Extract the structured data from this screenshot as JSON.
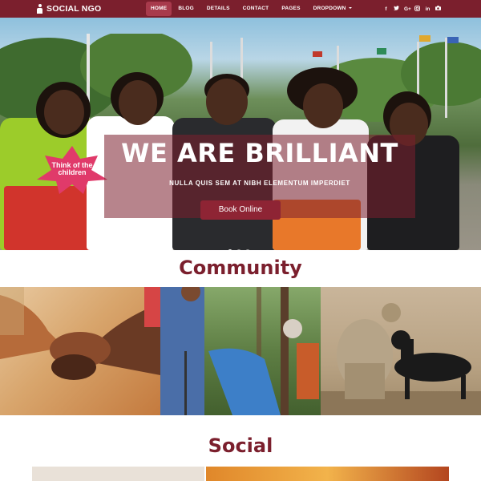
{
  "brand": {
    "name": "SOCIAL NGO"
  },
  "nav": {
    "items": [
      {
        "label": "HOME",
        "active": true
      },
      {
        "label": "BLOG"
      },
      {
        "label": "DETAILS"
      },
      {
        "label": "CONTACT"
      },
      {
        "label": "PAGES"
      },
      {
        "label": "DROPDOWN"
      }
    ],
    "social": [
      {
        "icon": "facebook-icon",
        "glyph": "f"
      },
      {
        "icon": "twitter-icon",
        "glyph": "t"
      },
      {
        "icon": "google-plus-icon",
        "glyph": "G+"
      },
      {
        "icon": "instagram-icon",
        "glyph": "◎"
      },
      {
        "icon": "linkedin-icon",
        "glyph": "in"
      },
      {
        "icon": "camera-icon",
        "glyph": "◙"
      }
    ]
  },
  "hero": {
    "title": "WE ARE BRILLIANT",
    "subtitle": "NULLA QUIS SEM AT NIBH ELEMENTUM IMPERDIET",
    "button": "Book Online",
    "slides": 3,
    "active_slide": 1,
    "sign_text": "Think of the children"
  },
  "sections": {
    "community": "Community",
    "social": "Social"
  },
  "colors": {
    "primary": "#7b1f2d",
    "accent": "#a83a4c"
  }
}
